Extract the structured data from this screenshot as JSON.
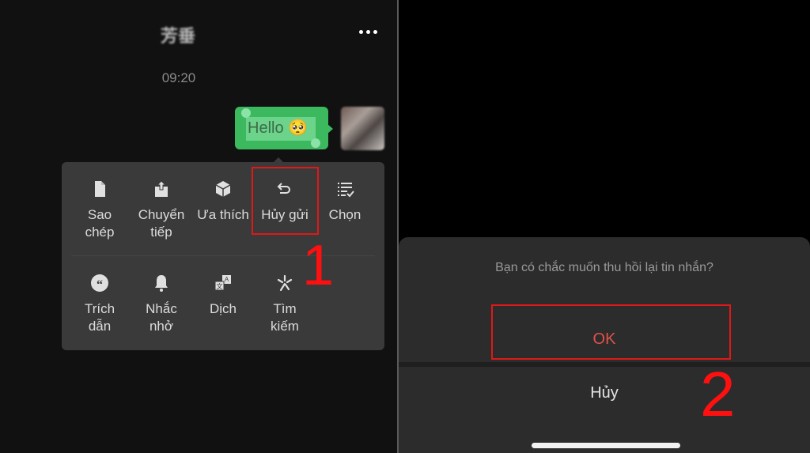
{
  "left_screen": {
    "chat_title": "芳垂",
    "more_icon": "more-horizontal-icon",
    "timestamp": "09:20",
    "message": {
      "text": "Hello",
      "emoji": "🥺",
      "bubble_color": "#3cb95f"
    },
    "menu": {
      "row1": [
        {
          "icon": "copy-icon",
          "label_line1": "Sao",
          "label_line2": "chép"
        },
        {
          "icon": "forward-icon",
          "label_line1": "Chuyển",
          "label_line2": "tiếp"
        },
        {
          "icon": "favorite-icon",
          "label_line1": "Ưa thích",
          "label_line2": ""
        },
        {
          "icon": "undo-icon",
          "label_line1": "Hủy gửi",
          "label_line2": ""
        },
        {
          "icon": "select-icon",
          "label_line1": "Chọn",
          "label_line2": ""
        }
      ],
      "row2": [
        {
          "icon": "quote-icon",
          "label_line1": "Trích",
          "label_line2": "dẫn"
        },
        {
          "icon": "bell-icon",
          "label_line1": "Nhắc",
          "label_line2": "nhở"
        },
        {
          "icon": "translate-icon",
          "label_line1": "Dịch",
          "label_line2": ""
        },
        {
          "icon": "search-sparkle-icon",
          "label_line1": "Tìm",
          "label_line2": "kiếm"
        }
      ]
    },
    "step_number": "1"
  },
  "right_screen": {
    "dialog": {
      "question": "Bạn có chắc muốn thu hồi lại tin nhắn?",
      "ok_label": "OK",
      "cancel_label": "Hủy",
      "ok_color": "#e0524a"
    },
    "step_number": "2"
  },
  "annotation_color": "#e01818"
}
